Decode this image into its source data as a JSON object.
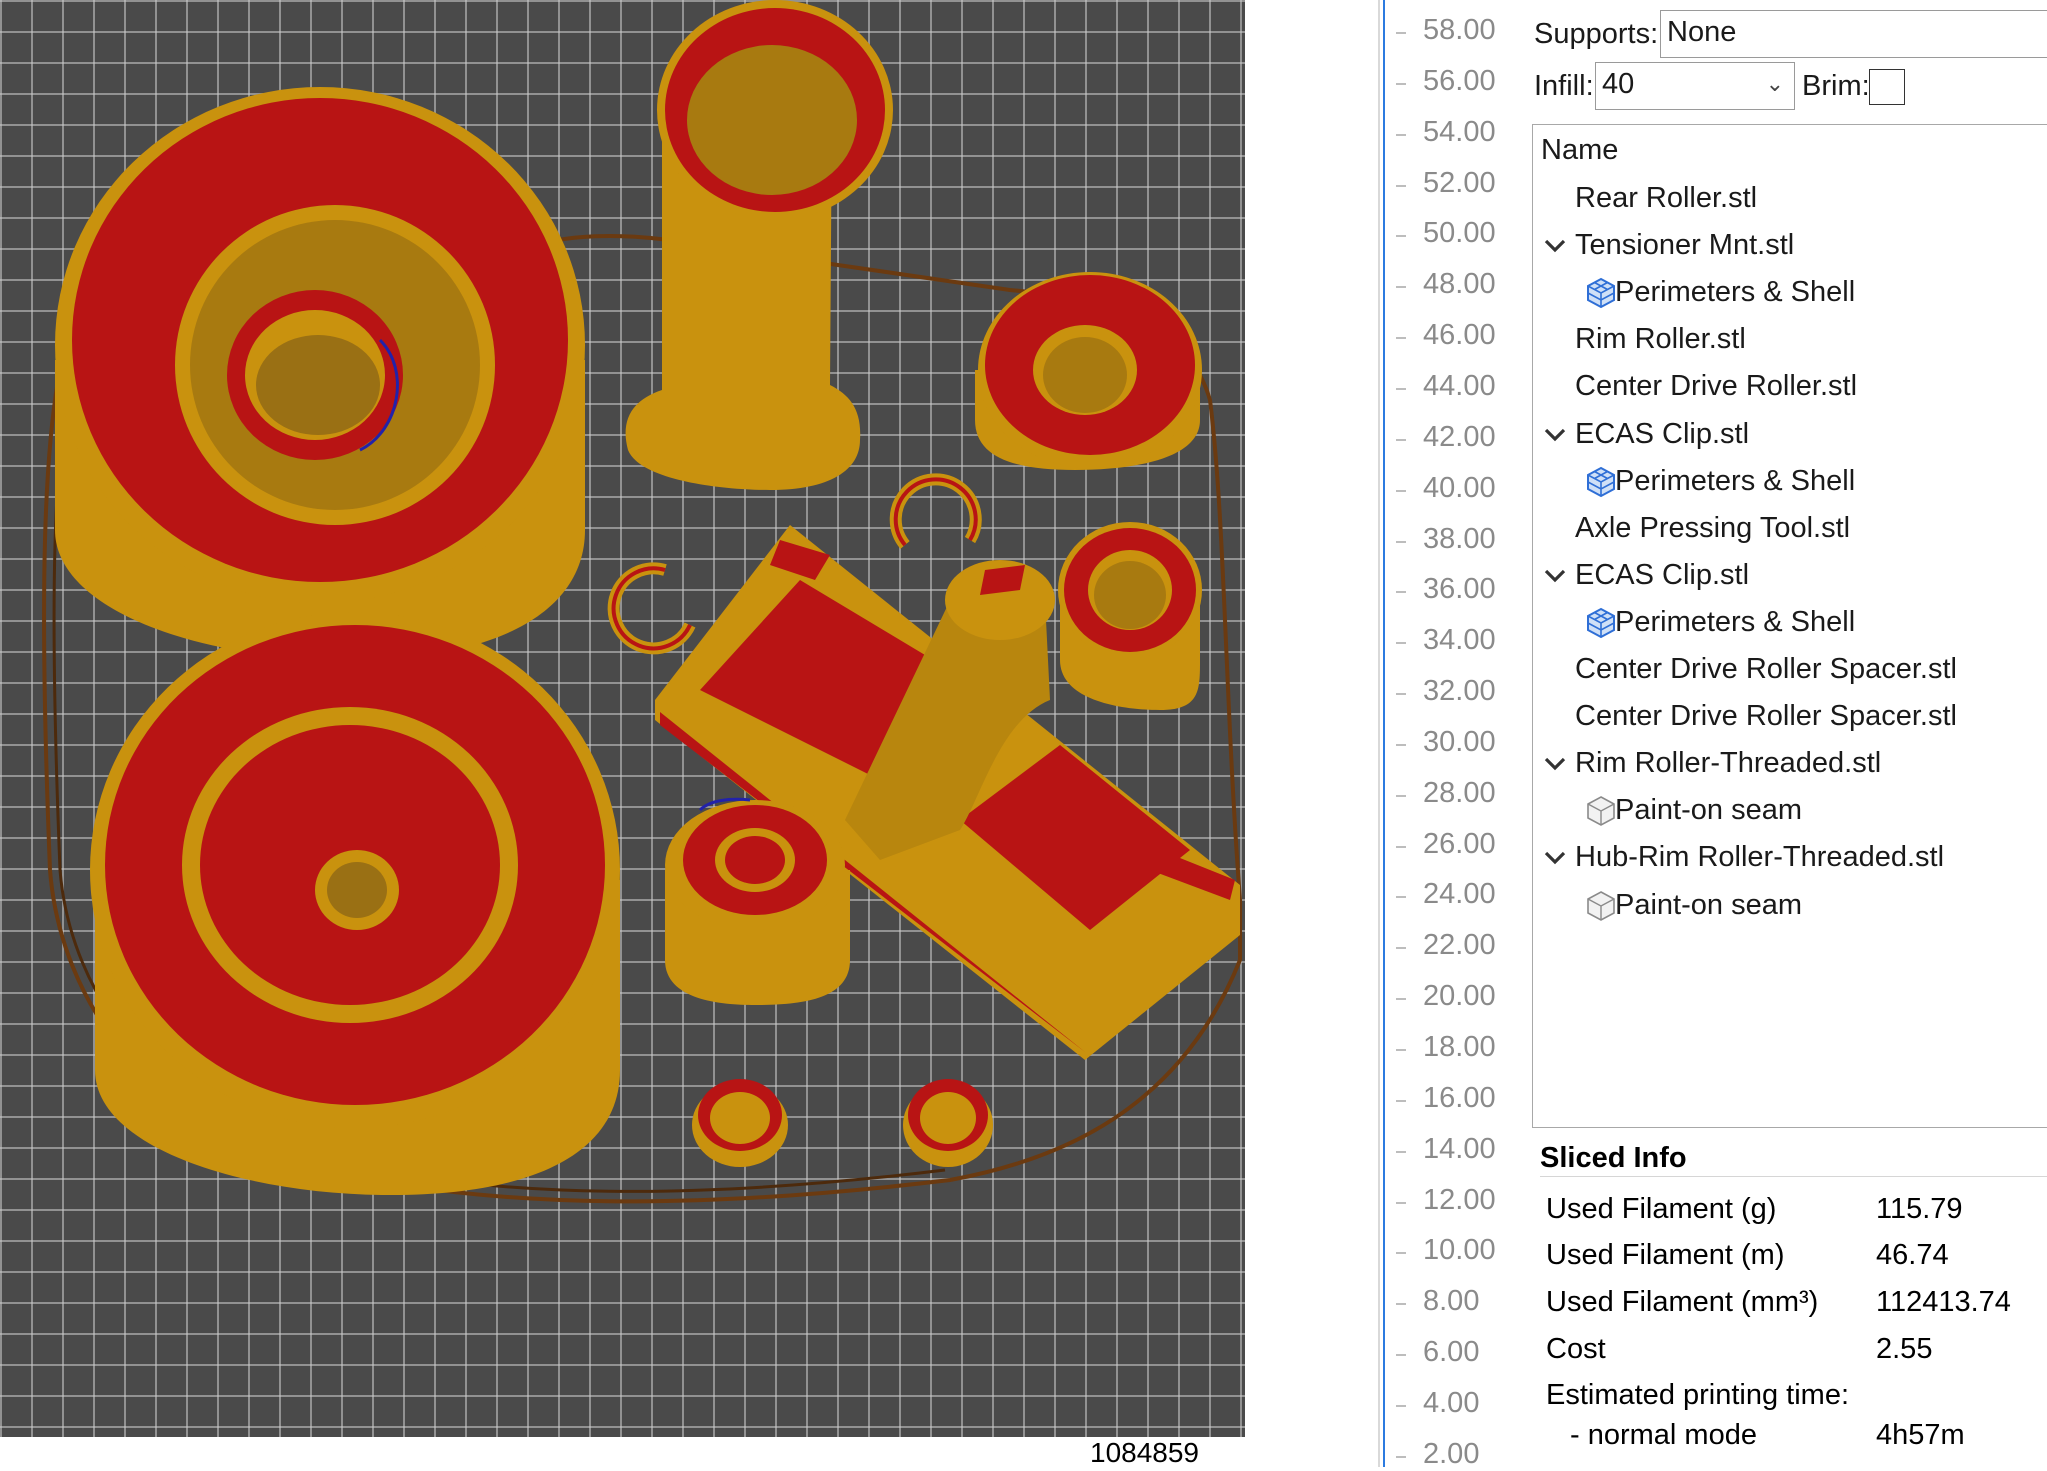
{
  "viewport": {
    "move_counter": "1084859",
    "colors": {
      "background": "#4a4a4a",
      "grid": "#cdcdcd",
      "perimeter": "#c9920e",
      "infill": "#b81414",
      "skirt": "#6b3a10"
    }
  },
  "layer_slider": {
    "ticks": [
      "58.00",
      "56.00",
      "54.00",
      "52.00",
      "50.00",
      "48.00",
      "46.00",
      "44.00",
      "42.00",
      "40.00",
      "38.00",
      "36.00",
      "34.00",
      "32.00",
      "30.00",
      "28.00",
      "26.00",
      "24.00",
      "22.00",
      "20.00",
      "18.00",
      "16.00",
      "14.00",
      "12.00",
      "10.00",
      "8.00",
      "6.00",
      "4.00",
      "2.00"
    ],
    "accent_color": "#2c7be0"
  },
  "settings": {
    "supports_label": "Supports:",
    "supports_value": "None",
    "infill_label": "Infill:",
    "infill_value": "40",
    "brim_label": "Brim:",
    "brim_checked": false
  },
  "object_list": {
    "header": "Name",
    "items": [
      {
        "label": "Rear Roller.stl",
        "level": 0,
        "expandable": false,
        "icon": ""
      },
      {
        "label": "Tensioner Mnt.stl",
        "level": 0,
        "expandable": true,
        "icon": ""
      },
      {
        "label": "Perimeters & Shell",
        "level": 1,
        "expandable": false,
        "icon": "mesh-settings-icon"
      },
      {
        "label": "Rim Roller.stl",
        "level": 0,
        "expandable": false,
        "icon": ""
      },
      {
        "label": "Center Drive Roller.stl",
        "level": 0,
        "expandable": false,
        "icon": ""
      },
      {
        "label": "ECAS Clip.stl",
        "level": 0,
        "expandable": true,
        "icon": ""
      },
      {
        "label": "Perimeters & Shell",
        "level": 1,
        "expandable": false,
        "icon": "mesh-settings-icon"
      },
      {
        "label": "Axle Pressing Tool.stl",
        "level": 0,
        "expandable": false,
        "icon": ""
      },
      {
        "label": "ECAS Clip.stl",
        "level": 0,
        "expandable": true,
        "icon": ""
      },
      {
        "label": "Perimeters & Shell",
        "level": 1,
        "expandable": false,
        "icon": "mesh-settings-icon"
      },
      {
        "label": "Center Drive Roller Spacer.stl",
        "level": 0,
        "expandable": false,
        "icon": ""
      },
      {
        "label": "Center Drive Roller Spacer.stl",
        "level": 0,
        "expandable": false,
        "icon": ""
      },
      {
        "label": "Rim Roller-Threaded.stl",
        "level": 0,
        "expandable": true,
        "icon": ""
      },
      {
        "label": "Paint-on seam",
        "level": 1,
        "expandable": false,
        "icon": "seam-cube-icon"
      },
      {
        "label": "Hub-Rim Roller-Threaded.stl",
        "level": 0,
        "expandable": true,
        "icon": ""
      },
      {
        "label": "Paint-on seam",
        "level": 1,
        "expandable": false,
        "icon": "seam-cube-icon"
      }
    ]
  },
  "sliced_info": {
    "title": "Sliced Info",
    "rows": [
      {
        "label": "Used Filament (g)",
        "value": "115.79"
      },
      {
        "label": "Used Filament (m)",
        "value": "46.74"
      },
      {
        "label": "Used Filament (mm³)",
        "value": "112413.74"
      },
      {
        "label": "Cost",
        "value": "2.55"
      },
      {
        "label": "Estimated printing time:",
        "value": ""
      },
      {
        "label": "- normal mode",
        "value": "4h57m"
      }
    ]
  }
}
